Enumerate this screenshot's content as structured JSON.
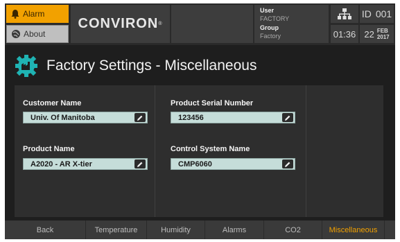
{
  "header": {
    "alarm_label": "Alarm",
    "about_label": "About",
    "brand": "CONVIRON",
    "user_label": "User",
    "user_value": "FACTORY",
    "group_label": "Group",
    "group_value": "Factory",
    "id_label": "ID",
    "id_value": "001",
    "time": "01:36",
    "day": "22",
    "month": "FEB",
    "year": "2017"
  },
  "page": {
    "title": "Factory Settings - Miscellaneous"
  },
  "fields": {
    "customer_name": {
      "label": "Customer Name",
      "value": "Univ. Of Manitoba"
    },
    "product_name": {
      "label": "Product Name",
      "value": "A2020 - AR X-tier"
    },
    "serial_number": {
      "label": "Product Serial Number",
      "value": "123456"
    },
    "control_system": {
      "label": "Control System Name",
      "value": "CMP6060"
    }
  },
  "tabs": [
    {
      "label": "Back",
      "active": false
    },
    {
      "label": "Temperature",
      "active": false
    },
    {
      "label": "Humidity",
      "active": false
    },
    {
      "label": "Alarms",
      "active": false
    },
    {
      "label": "CO2",
      "active": false
    },
    {
      "label": "Miscellaneous",
      "active": true
    }
  ],
  "colors": {
    "accent": "#f2a100",
    "field_bg": "#c5ddd9",
    "icon_teal": "#1fb3b3"
  },
  "icons": {
    "alarm": "bell-icon",
    "about": "globe-icon",
    "network": "network-icon",
    "page": "factory-gear-icon",
    "edit": "pencil-icon"
  }
}
